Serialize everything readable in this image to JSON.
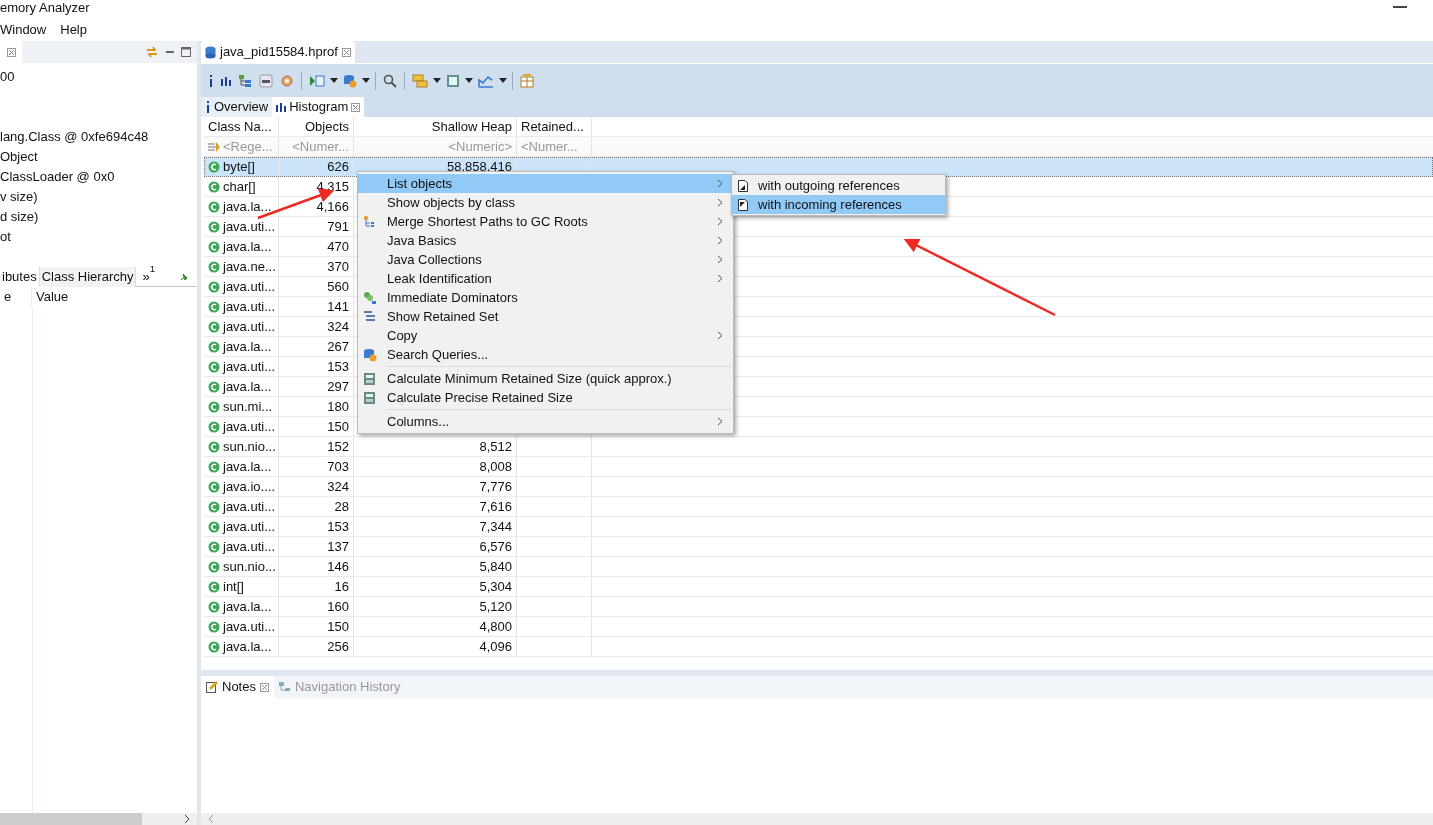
{
  "window": {
    "title": "emory Analyzer"
  },
  "menu_bar": [
    "Window",
    "Help"
  ],
  "left_panel": {
    "lines": [
      "00",
      "lang.Class @ 0xfe694c48",
      "Object",
      "ClassLoader @ 0x0",
      "v size)",
      "d size)",
      "ot"
    ],
    "tabs": [
      {
        "label": "ibutes",
        "selected": true
      },
      {
        "label": "Class Hierarchy",
        "selected": false
      }
    ],
    "overflow": "»",
    "overflow_count": "1",
    "columns": [
      "e",
      "Value"
    ]
  },
  "editor": {
    "tab": "java_pid15584.hprof",
    "subtabs": [
      {
        "label": "Overview",
        "selected": false
      },
      {
        "label": "Histogram",
        "selected": true
      }
    ],
    "table": {
      "columns": [
        "Class Na...",
        "Objects",
        "Shallow Heap",
        "Retained..."
      ],
      "filters": [
        "<Rege...",
        "<Numer...",
        "<Numeric>",
        "<Numer..."
      ],
      "rows": [
        {
          "class_name": "byte[]",
          "objects": "626",
          "shallow_heap": "58,858,416",
          "selected": true
        },
        {
          "class_name": "char[]",
          "objects": "4,315",
          "selected": false
        },
        {
          "class_name": "java.la...",
          "objects": "4,166",
          "selected": false
        },
        {
          "class_name": "java.uti...",
          "objects": "791",
          "selected": false
        },
        {
          "class_name": "java.la...",
          "objects": "470",
          "selected": false
        },
        {
          "class_name": "java.ne...",
          "objects": "370",
          "selected": false
        },
        {
          "class_name": "java.uti...",
          "objects": "560",
          "selected": false
        },
        {
          "class_name": "java.uti...",
          "objects": "141",
          "selected": false
        },
        {
          "class_name": "java.uti...",
          "objects": "324",
          "selected": false
        },
        {
          "class_name": "java.la...",
          "objects": "267",
          "selected": false
        },
        {
          "class_name": "java.uti...",
          "objects": "153",
          "selected": false
        },
        {
          "class_name": "java.la...",
          "objects": "297",
          "selected": false
        },
        {
          "class_name": "sun.mi...",
          "objects": "180",
          "selected": false
        },
        {
          "class_name": "java.uti...",
          "objects": "150",
          "selected": false
        },
        {
          "class_name": "sun.nio...",
          "objects": "152",
          "shallow_heap": "8,512",
          "selected": false
        },
        {
          "class_name": "java.la...",
          "objects": "703",
          "shallow_heap": "8,008",
          "selected": false
        },
        {
          "class_name": "java.io....",
          "objects": "324",
          "shallow_heap": "7,776",
          "selected": false
        },
        {
          "class_name": "java.uti...",
          "objects": "28",
          "shallow_heap": "7,616",
          "selected": false
        },
        {
          "class_name": "java.uti...",
          "objects": "153",
          "shallow_heap": "7,344",
          "selected": false
        },
        {
          "class_name": "java.uti...",
          "objects": "137",
          "shallow_heap": "6,576",
          "selected": false
        },
        {
          "class_name": "sun.nio...",
          "objects": "146",
          "shallow_heap": "5,840",
          "selected": false
        },
        {
          "class_name": "int[]",
          "objects": "16",
          "shallow_heap": "5,304",
          "selected": false
        },
        {
          "class_name": "java.la...",
          "objects": "160",
          "shallow_heap": "5,120",
          "selected": false
        },
        {
          "class_name": "java.uti...",
          "objects": "150",
          "shallow_heap": "4,800",
          "selected": false
        },
        {
          "class_name": "java.la...",
          "objects": "256",
          "shallow_heap": "4,096",
          "selected": false
        }
      ]
    }
  },
  "context_menu": {
    "items": [
      {
        "kind": "plain",
        "label": "List objects",
        "submenu": true,
        "selected": true
      },
      {
        "kind": "plain",
        "label": "Show objects by class",
        "submenu": true,
        "selected": false
      },
      {
        "kind": "paths",
        "label": "Merge Shortest Paths to GC Roots",
        "submenu": true,
        "selected": false
      },
      {
        "kind": "plain",
        "label": "Java Basics",
        "submenu": true,
        "selected": false
      },
      {
        "kind": "plain",
        "label": "Java Collections",
        "submenu": true,
        "selected": false
      },
      {
        "kind": "plain",
        "label": "Leak Identification",
        "submenu": true,
        "selected": false
      },
      {
        "kind": "dominators",
        "label": "Immediate Dominators",
        "submenu": false,
        "selected": false
      },
      {
        "kind": "retained",
        "label": "Show Retained Set",
        "submenu": false,
        "selected": false
      },
      {
        "kind": "plain",
        "label": "Copy",
        "submenu": true,
        "selected": false
      },
      {
        "kind": "queries",
        "label": "Search Queries...",
        "submenu": false,
        "selected": false
      },
      {
        "kind": "separator"
      },
      {
        "kind": "calc",
        "label": "Calculate Minimum Retained Size (quick approx.)",
        "submenu": false,
        "selected": false
      },
      {
        "kind": "calc",
        "label": "Calculate Precise Retained Size",
        "submenu": false,
        "selected": false
      },
      {
        "kind": "separator"
      },
      {
        "kind": "plain",
        "label": "Columns...",
        "submenu": true,
        "selected": false
      }
    ],
    "submenu": [
      {
        "label": "with outgoing references",
        "selected": false
      },
      {
        "label": "with incoming references",
        "selected": true
      }
    ]
  },
  "bottom_panel": {
    "tabs": [
      {
        "label": "Notes",
        "selected": true
      },
      {
        "label": "Navigation History",
        "selected": false
      }
    ]
  }
}
